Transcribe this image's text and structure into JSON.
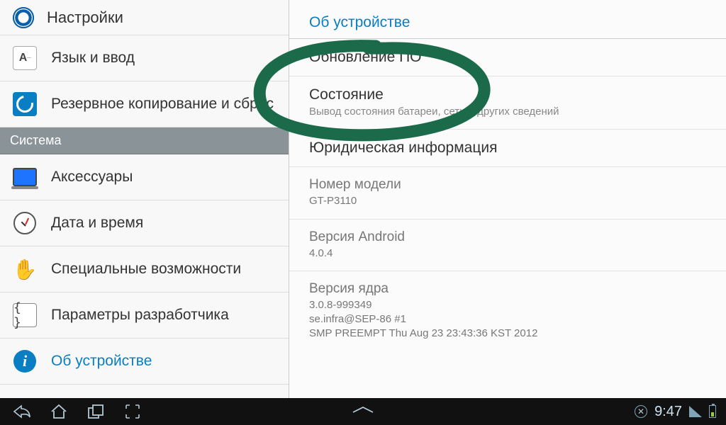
{
  "header": {
    "title": "Настройки"
  },
  "left_items": {
    "lang": "Язык и ввод",
    "backup": "Резервное копирование и сброс",
    "section_system": "Система",
    "accessories": "Аксессуары",
    "datetime": "Дата и время",
    "accessibility": "Специальные возможности",
    "developer": "Параметры разработчика",
    "about": "Об устройстве"
  },
  "detail": {
    "header": "Об устройстве",
    "update": "Обновление ПО",
    "status_title": "Состояние",
    "status_sub": "Вывод состояния батареи, сети и других сведений",
    "legal": "Юридическая информация",
    "model_title": "Номер модели",
    "model_value": "GT-P3110",
    "android_title": "Версия Android",
    "android_value": "4.0.4",
    "kernel_title": "Версия ядра",
    "kernel_value": "3.0.8-999349\nse.infra@SEP-86 #1\nSMP PREEMPT Thu Aug 23 23:43:36 KST 2012"
  },
  "statusbar": {
    "time": "9:47"
  }
}
